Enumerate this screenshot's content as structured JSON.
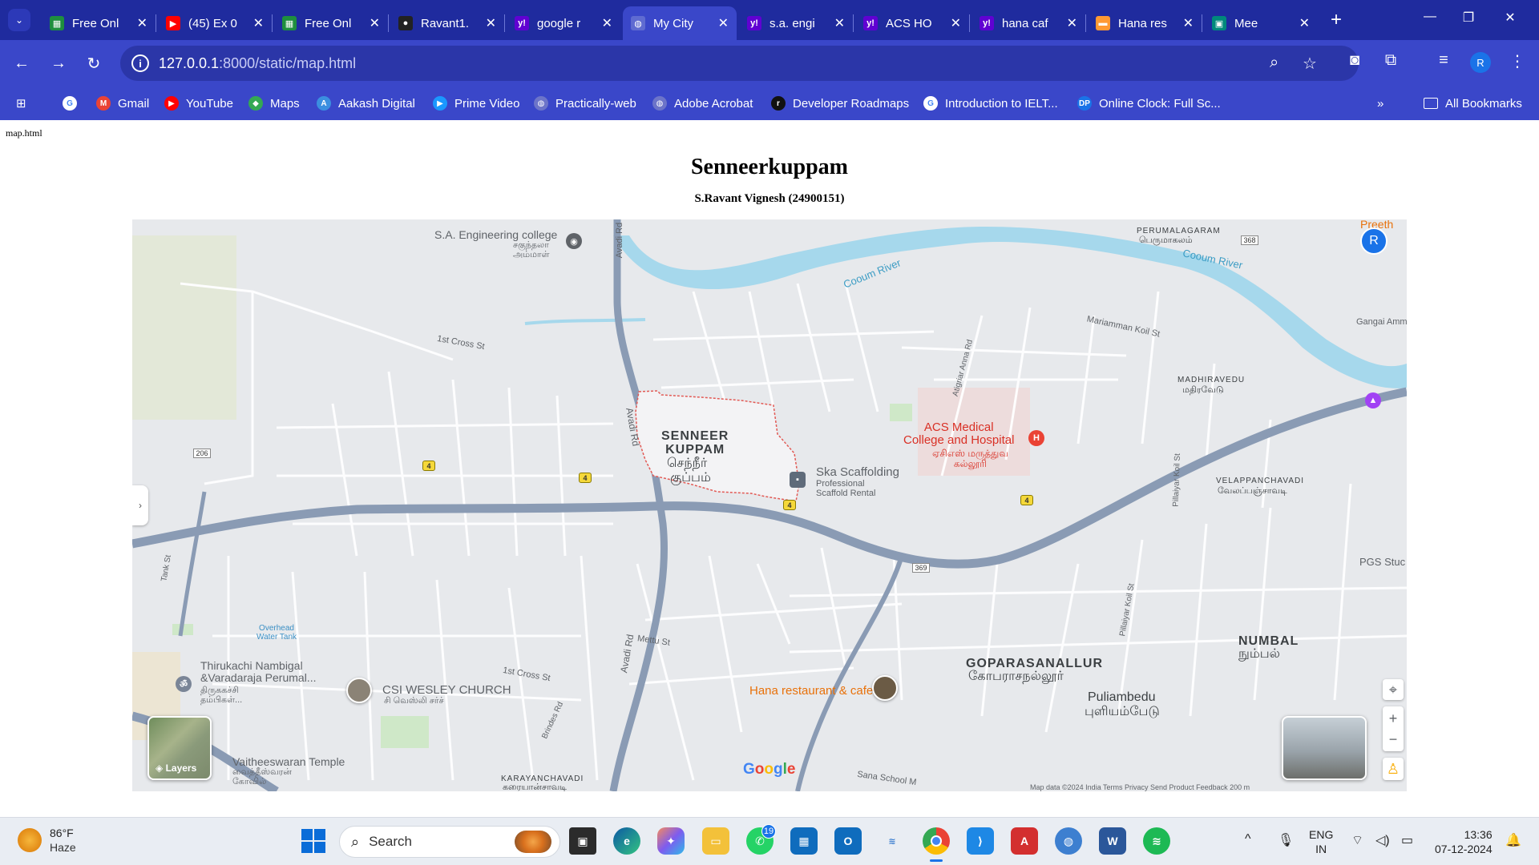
{
  "browser": {
    "tabs": [
      {
        "title": "Free Onl",
        "icon": "sheets-icon",
        "color": "#1e8e3e",
        "glyph": "▦"
      },
      {
        "title": "(45) Ex 0",
        "icon": "youtube-icon",
        "color": "#ff0000",
        "glyph": "▶"
      },
      {
        "title": "Free Onl",
        "icon": "sheets-icon",
        "color": "#1e8e3e",
        "glyph": "▦"
      },
      {
        "title": "Ravant1.",
        "icon": "github-icon",
        "color": "#222222",
        "glyph": "●"
      },
      {
        "title": "google r",
        "icon": "yahoo-icon",
        "color": "#6001d2",
        "glyph": "y!"
      },
      {
        "title": "My City",
        "icon": "globe-icon",
        "color": "#5f6bd1",
        "glyph": "◍"
      },
      {
        "title": "s.a. engi",
        "icon": "yahoo-icon",
        "color": "#6001d2",
        "glyph": "y!"
      },
      {
        "title": "ACS HO",
        "icon": "yahoo-icon",
        "color": "#6001d2",
        "glyph": "y!"
      },
      {
        "title": "hana caf",
        "icon": "yahoo-icon",
        "color": "#6001d2",
        "glyph": "y!"
      },
      {
        "title": "Hana res",
        "icon": "flag-india-icon",
        "color": "#ff9933",
        "glyph": "▬"
      },
      {
        "title": "Mee",
        "icon": "meet-icon",
        "color": "#00897b",
        "glyph": "▣"
      }
    ],
    "active_tab_index": 5,
    "url_host": "127.0.0.1",
    "url_rest": ":8000/static/map.html",
    "bookmarks": [
      {
        "label": "",
        "icon": "google-icon",
        "color": "#ffffff",
        "glyph": "G"
      },
      {
        "label": "Gmail",
        "icon": "gmail-icon",
        "color": "#ea4335",
        "glyph": "M"
      },
      {
        "label": "YouTube",
        "icon": "youtube-icon",
        "color": "#ff0000",
        "glyph": "▶"
      },
      {
        "label": "Maps",
        "icon": "maps-pin-icon",
        "color": "#34a853",
        "glyph": "◆"
      },
      {
        "label": "Aakash Digital",
        "icon": "aakash-icon",
        "color": "#3b8fe0",
        "glyph": "A"
      },
      {
        "label": "Prime Video",
        "icon": "prime-video-icon",
        "color": "#1a98ff",
        "glyph": "▶"
      },
      {
        "label": "Practically-web",
        "icon": "globe-icon",
        "color": "#6c74c9",
        "glyph": "◍"
      },
      {
        "label": "Adobe Acrobat",
        "icon": "globe-icon",
        "color": "#6c74c9",
        "glyph": "◍"
      },
      {
        "label": "Developer Roadmaps",
        "icon": "roadmap-icon",
        "color": "#111111",
        "glyph": "r"
      },
      {
        "label": "Introduction to IELT...",
        "icon": "google-icon",
        "color": "#ffffff",
        "glyph": "G"
      },
      {
        "label": "Online Clock: Full Sc...",
        "icon": "dp-icon",
        "color": "#1a73e8",
        "glyph": "DP"
      }
    ],
    "all_bookmarks": "All Bookmarks",
    "profile_initial": "R"
  },
  "page": {
    "filename": "map.html",
    "title": "Senneerkuppam",
    "subtitle": "S.Ravant Vignesh (24900151)"
  },
  "map": {
    "area_en_1": "SENNEER",
    "area_en_2": "KUPPAM",
    "area_ta_1": "செந்நீர்",
    "area_ta_2": "குப்பம்",
    "sa_college": "S.A. Engineering college",
    "sa_college_ta": "சகுந்தலா",
    "sa_college_ta2": "அம்மாள்",
    "acs_1": "ACS Medical",
    "acs_2": "College and Hospital",
    "acs_ta_1": "ஏசிஎஸ் மருத்துவ",
    "acs_ta_2": "கல்லூரி",
    "ska": "Ska Scaffolding",
    "ska_sub_1": "Professional",
    "ska_sub_2": "Scaffold Rental",
    "hana": "Hana restaurant & cafe",
    "csi": "CSI WESLEY CHURCH",
    "csi_ta": "சி வெஸ்லி சர்ச்",
    "thiru_1": "Thirukachi Nambigal",
    "thiru_2": "&Varadaraja Perumal...",
    "thiru_ta_1": "திருககச்சி",
    "thiru_ta_2": "தம்பிகள்...",
    "vaith": "Vaitheeswaran Temple",
    "vaith_ta_1": "வைத்தீஸ்வரன்",
    "vaith_ta_2": "கோவில்",
    "gopara": "GOPARASANALLUR",
    "gopara_ta": "கோபராசநல்லூர்",
    "puliam": "Puliambedu",
    "puliam_ta": "புளியம்பேடு",
    "numbal": "NUMBAL",
    "numbal_ta": "நும்பல்",
    "madhira": "MADHIRAVEDU",
    "madhira_ta": "மதிரவேடு",
    "velappan": "VELAPPANCHAVADI",
    "velappan_ta": "வேலப்பஞ்சாவடி",
    "perumal": "PERUMALAGARAM",
    "perumal_ta": "பெருமாகலம்",
    "karayan": "KARAYANCHAVADI",
    "karayan_ta": "கரையான்சாவடி",
    "coovum_1": "Cooum River",
    "coovum_2": "Cooum River",
    "avadi_1": "Avadi Rd",
    "avadi_2": "Avadi Rd",
    "avadi_3": "Avadi Rd",
    "first_cross_1": "1st Cross St",
    "first_cross_2": "1st Cross St",
    "mettu": "Mettu St",
    "mariamman": "Mariamman Koil St",
    "atigriar": "Atigriar Anna Rd",
    "pillaiyar_1": "Pillaiyar Koil St",
    "pillaiyar_2": "Pillaiyar Koil St",
    "brindes": "Brindes Rd",
    "tank": "Tank St",
    "overhead_1": "Overhead",
    "overhead_2": "Water Tank",
    "pgs": "PGS Stuc",
    "preeth": "Preeth",
    "gangai": "Gangai Amma",
    "sanal": "Sana School M",
    "shield_4": "4",
    "shield_206": "206",
    "shield_369": "369",
    "shield_368": "368",
    "layers": "Layers",
    "google": "Google",
    "attribution": "Map data ©2024   India   Terms   Privacy   Send Product Feedback   200 m",
    "avatar_initial": "R"
  },
  "taskbar": {
    "temp": "86°F",
    "condition": "Haze",
    "search_placeholder": "Search",
    "whatsapp_badge": "19",
    "lang_1": "ENG",
    "lang_2": "IN",
    "time": "13:36",
    "date": "07-12-2024"
  }
}
